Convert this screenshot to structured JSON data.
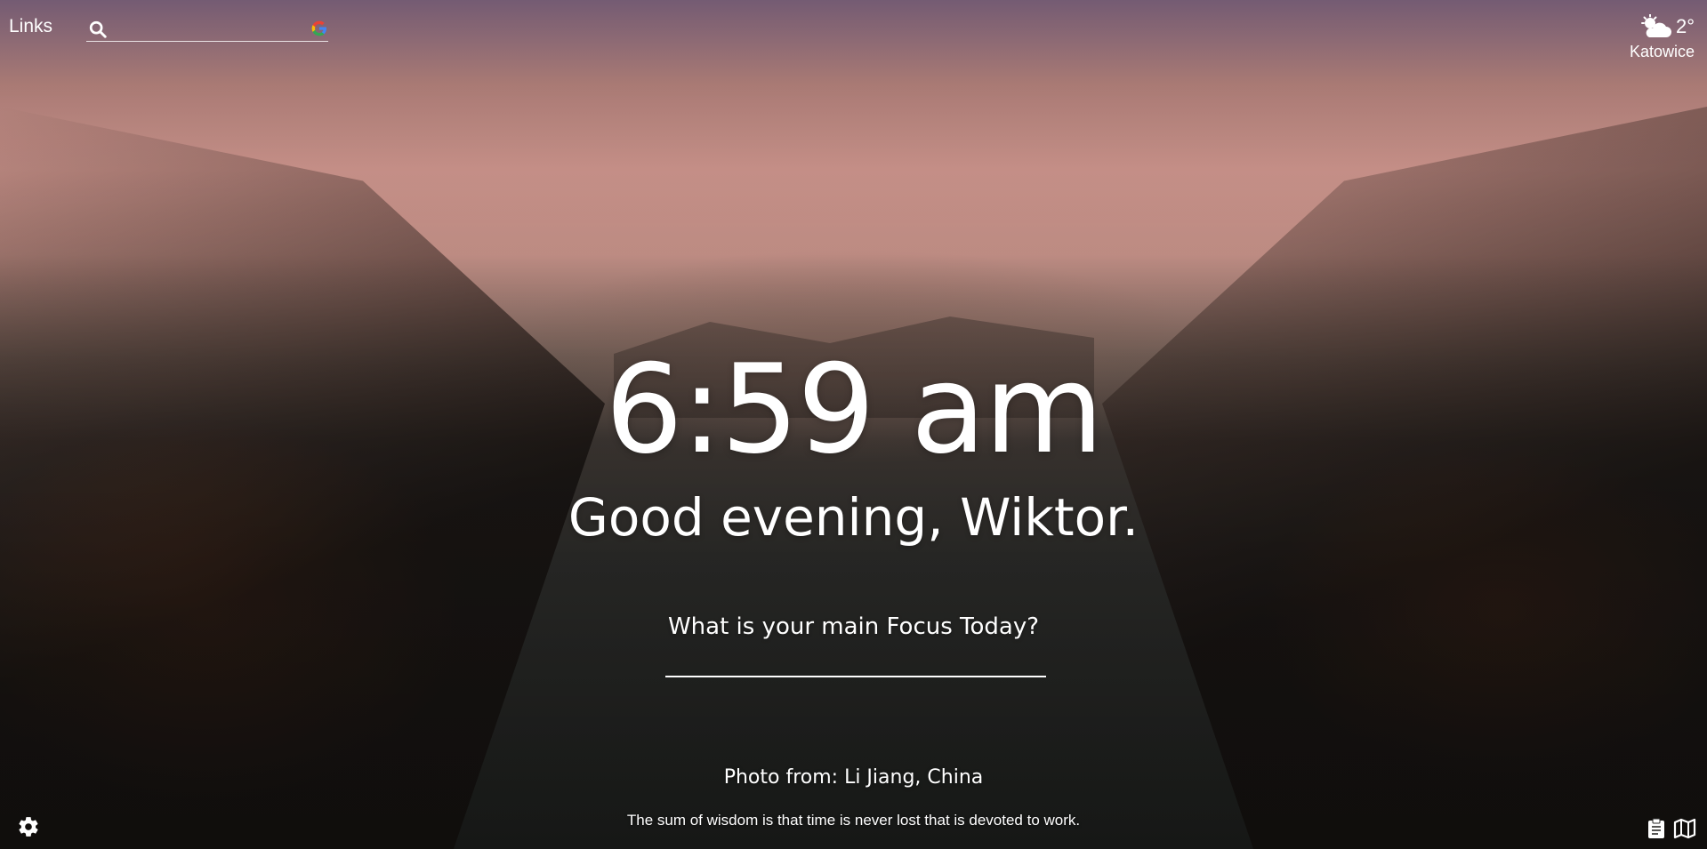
{
  "topbar": {
    "links_label": "Links",
    "search": {
      "placeholder": "",
      "value": ""
    }
  },
  "weather": {
    "icon": "partly-cloudy-night-icon",
    "temperature": "2°",
    "location": "Katowice"
  },
  "main": {
    "time": "6:59 am",
    "greeting": "Good evening, Wiktor.",
    "focus_prompt": "What is your main Focus Today?",
    "focus_value": ""
  },
  "footer": {
    "photo_credit": "Photo from: Li Jiang, China",
    "quote": "The sum of wisdom is that time is never lost that is devoted to work.",
    "icons": [
      "gear-icon",
      "clipboard-icon",
      "map-icon"
    ]
  },
  "colors": {
    "text": "#ffffff",
    "google_blue": "#4285F4",
    "google_red": "#EA4335",
    "google_yellow": "#FBBC05",
    "google_green": "#34A853"
  }
}
